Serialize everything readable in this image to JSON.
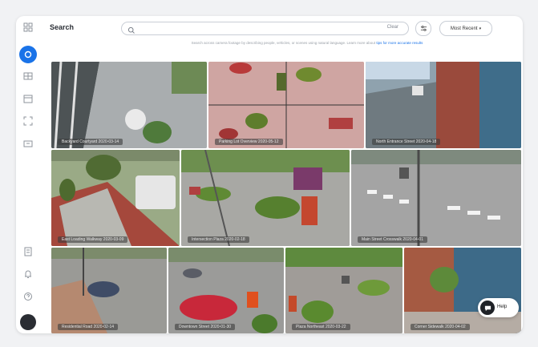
{
  "page": {
    "title": "Search"
  },
  "search": {
    "placeholder": "",
    "value": "",
    "clear_label": "Clear"
  },
  "sort": {
    "label": "Most Recent"
  },
  "hint": {
    "text": "Search across camera footage by describing people, vehicles, or scenes using natural language. Learn more about",
    "link": "tips for more accurate results"
  },
  "sidebar": {
    "top_icons": [
      "grid-icon"
    ],
    "nav_icons": [
      "search-icon",
      "layout-icon",
      "calendar-icon",
      "scan-icon",
      "archive-icon"
    ],
    "bottom_icons": [
      "document-icon",
      "bell-icon",
      "help-icon"
    ]
  },
  "cameras": [
    {
      "label": "Backyard Courtyard 2020-03-14"
    },
    {
      "label": "Parking Lot Overview 2020-05-12"
    },
    {
      "label": "North Entrance Street 2020-04-18"
    },
    {
      "label": "East Loading Walkway 2020-03-09"
    },
    {
      "label": "Intersection Plaza 2020-02-18"
    },
    {
      "label": "Main Street Crosswalk 2020-04-01"
    },
    {
      "label": "Residential Road 2020-02-14"
    },
    {
      "label": "Downtown Street 2020-01-30"
    },
    {
      "label": "Plaza Northeast 2020-03-22"
    },
    {
      "label": "Corner Sidewalk 2020-04-02"
    }
  ],
  "chat": {
    "label": "Help"
  }
}
